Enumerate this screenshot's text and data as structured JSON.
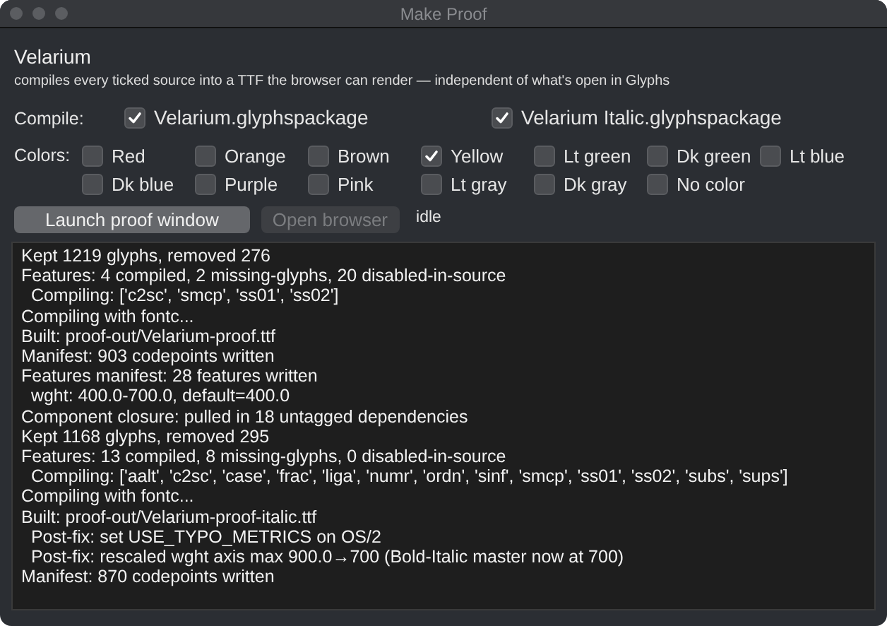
{
  "window": {
    "title": "Make Proof"
  },
  "heading": "Velarium",
  "subtitle": "compiles every ticked source into a TTF the browser can render — independent of what's open in Glyphs",
  "compile": {
    "label": "Compile:",
    "sources": [
      {
        "label": "Velarium.glyphspackage",
        "checked": true
      },
      {
        "label": "Velarium Italic.glyphspackage",
        "checked": true
      }
    ]
  },
  "colors": {
    "label": "Colors:",
    "options": [
      {
        "label": "Red",
        "checked": false
      },
      {
        "label": "Orange",
        "checked": false
      },
      {
        "label": "Brown",
        "checked": false
      },
      {
        "label": "Yellow",
        "checked": true
      },
      {
        "label": "Lt green",
        "checked": false
      },
      {
        "label": "Dk green",
        "checked": false
      },
      {
        "label": "Lt blue",
        "checked": false
      },
      {
        "label": "Dk blue",
        "checked": false
      },
      {
        "label": "Purple",
        "checked": false
      },
      {
        "label": "Pink",
        "checked": false
      },
      {
        "label": "Lt gray",
        "checked": false
      },
      {
        "label": "Dk gray",
        "checked": false
      },
      {
        "label": "No color",
        "checked": false
      }
    ]
  },
  "actions": [
    {
      "label": "Launch proof window",
      "disabled": false
    },
    {
      "label": "Open browser",
      "disabled": true
    }
  ],
  "status": "idle",
  "log": [
    "Kept 1219 glyphs, removed 276",
    "Features: 4 compiled, 2 missing-glyphs, 20 disabled-in-source",
    "  Compiling: ['c2sc', 'smcp', 'ss01', 'ss02']",
    "Compiling with fontc...",
    "Built: proof-out/Velarium-proof.ttf",
    "Manifest: 903 codepoints written",
    "Features manifest: 28 features written",
    "  wght: 400.0-700.0, default=400.0",
    "Component closure: pulled in 18 untagged dependencies",
    "Kept 1168 glyphs, removed 295",
    "Features: 13 compiled, 8 missing-glyphs, 0 disabled-in-source",
    "  Compiling: ['aalt', 'c2sc', 'case', 'frac', 'liga', 'numr', 'ordn', 'sinf', 'smcp', 'ss01', 'ss02', 'subs', 'sups']",
    "Compiling with fontc...",
    "Built: proof-out/Velarium-proof-italic.ttf",
    "  Post-fix: set USE_TYPO_METRICS on OS/2",
    "  Post-fix: rescaled wght axis max 900.0→700 (Bold-Italic master now at 700)",
    "Manifest: 870 codepoints written"
  ]
}
